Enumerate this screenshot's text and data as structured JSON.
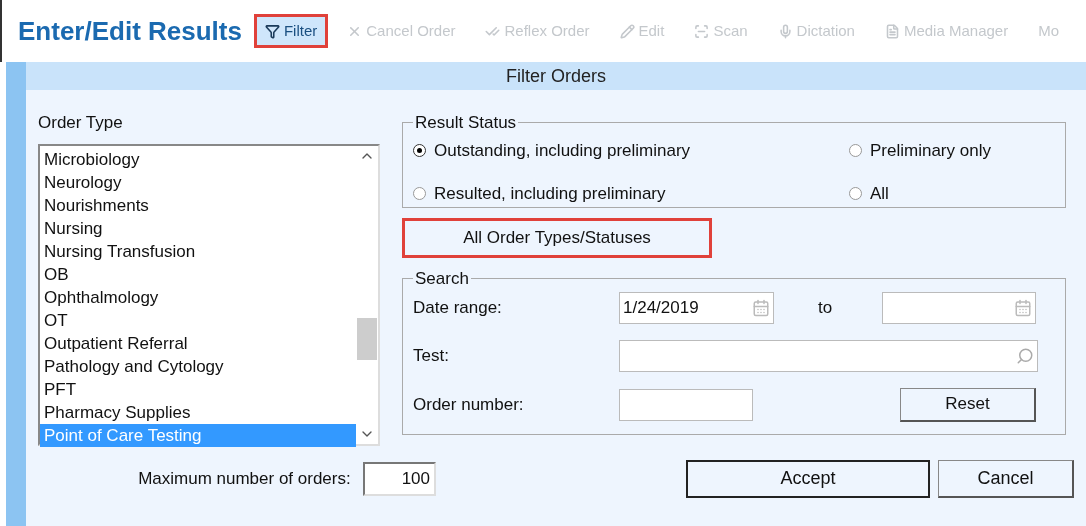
{
  "header": {
    "title": "Enter/Edit Results",
    "toolbar": [
      {
        "label": "Filter",
        "disabled": false,
        "highlighted": true
      },
      {
        "label": "Cancel Order",
        "disabled": true,
        "highlighted": false
      },
      {
        "label": "Reflex Order",
        "disabled": true,
        "highlighted": false
      },
      {
        "label": "Edit",
        "disabled": true,
        "highlighted": false
      },
      {
        "label": "Scan",
        "disabled": true,
        "highlighted": false
      },
      {
        "label": "Dictation",
        "disabled": true,
        "highlighted": false
      },
      {
        "label": "Media Manager",
        "disabled": true,
        "highlighted": false
      },
      {
        "label": "Mo",
        "disabled": true,
        "highlighted": false
      }
    ]
  },
  "dialog": {
    "title": "Filter Orders",
    "order_type": {
      "label": "Order Type",
      "items": [
        {
          "label": "Microbiology",
          "selected": false
        },
        {
          "label": "Neurology",
          "selected": false
        },
        {
          "label": "Nourishments",
          "selected": false
        },
        {
          "label": "Nursing",
          "selected": false
        },
        {
          "label": "Nursing Transfusion",
          "selected": false
        },
        {
          "label": "OB",
          "selected": false
        },
        {
          "label": "Ophthalmology",
          "selected": false
        },
        {
          "label": "OT",
          "selected": false
        },
        {
          "label": "Outpatient Referral",
          "selected": false
        },
        {
          "label": "Pathology and Cytology",
          "selected": false
        },
        {
          "label": "PFT",
          "selected": false
        },
        {
          "label": "Pharmacy Supplies",
          "selected": false
        },
        {
          "label": "Point of Care Testing",
          "selected": true
        }
      ]
    },
    "max_orders": {
      "label": "Maximum number of orders:",
      "value": "100"
    },
    "result_status": {
      "label": "Result Status",
      "options": [
        {
          "label": "Outstanding, including preliminary",
          "selected": true
        },
        {
          "label": "Preliminary only",
          "selected": false
        },
        {
          "label": "Resulted, including preliminary",
          "selected": false
        },
        {
          "label": "All",
          "selected": false
        }
      ]
    },
    "all_button": {
      "label": "All Order Types/Statuses",
      "highlighted": true
    },
    "search": {
      "label": "Search",
      "date_range_label": "Date range:",
      "date_from": "1/24/2019",
      "to_label": "to",
      "test_label": "Test:",
      "order_number_label": "Order number:",
      "reset": "Reset"
    },
    "buttons": [
      {
        "label": "Accept",
        "default": true
      },
      {
        "label": "Cancel",
        "default": false
      }
    ]
  }
}
